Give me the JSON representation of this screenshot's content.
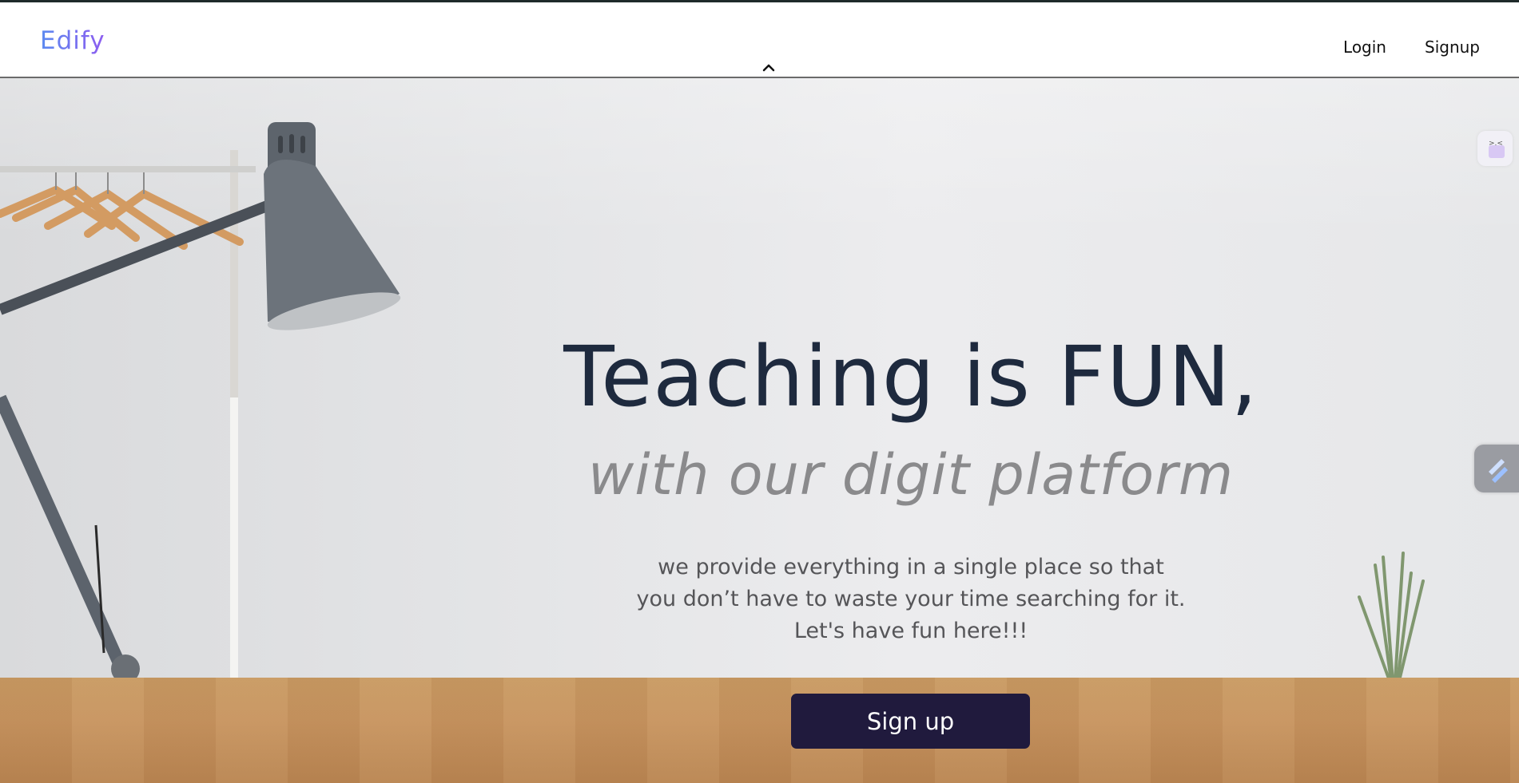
{
  "brand": {
    "name": "Edify"
  },
  "nav": {
    "login": "Login",
    "signup": "Signup"
  },
  "hero": {
    "headline": "Teaching is FUN,",
    "subheadline": "with our digit platform",
    "description": [
      "we provide everything in a single place so that",
      "you don’t have to waste your time searching for it.",
      "Let's have fun here!!!"
    ],
    "cta_label": "Sign up"
  },
  "icons": {
    "collapse": "chevron-up-icon",
    "side_widget_top": "face-icon",
    "side_widget_bottom": "lightning-icon"
  },
  "colors": {
    "brand_gradient": [
      "#5b8af0",
      "#8e5cf0"
    ],
    "headline": "#1e2a3e",
    "cta_bg": "#201a3d",
    "cta_text": "#ffffff"
  }
}
